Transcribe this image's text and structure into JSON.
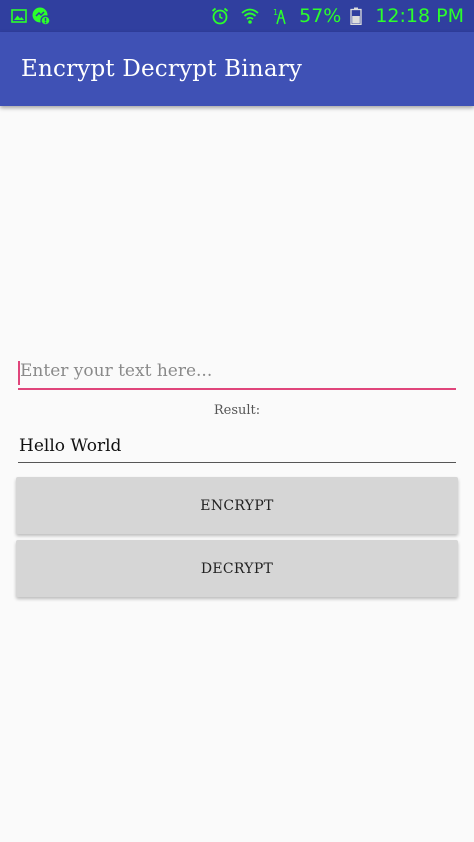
{
  "status_bar": {
    "left_icons": [
      "image-icon",
      "messenger-icon"
    ],
    "right_icons": [
      "alarm-icon",
      "wifi-icon",
      "signal-icon",
      "battery-icon"
    ],
    "battery_percent": "57%",
    "time": "12:18 PM",
    "text_color": "#2bff2b",
    "background": "#303f9f"
  },
  "app_bar": {
    "title": "Encrypt Decrypt Binary",
    "background": "#3f51b5"
  },
  "input": {
    "placeholder": "Enter your text here...",
    "accent_color": "#e0457b"
  },
  "result": {
    "label": "Result:",
    "value": "Hello World"
  },
  "buttons": {
    "encrypt_label": "ENCRYPT",
    "decrypt_label": "DECRYPT"
  }
}
